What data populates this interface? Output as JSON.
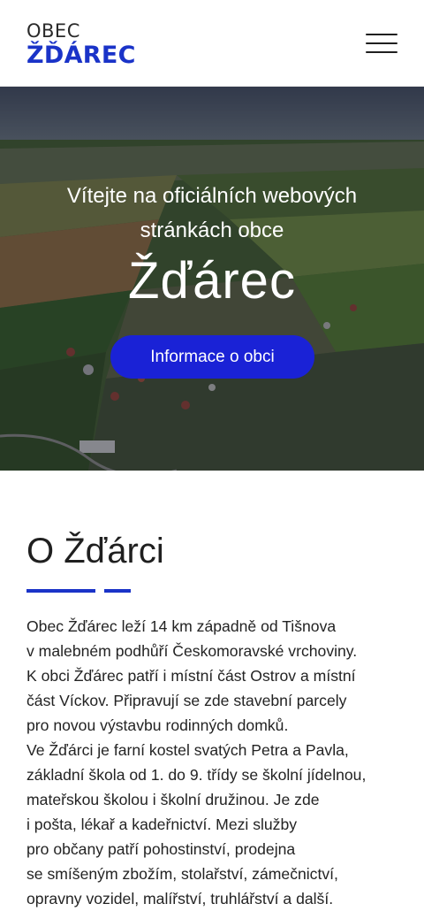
{
  "header": {
    "logo_small": "OBEC",
    "logo_big": "ŽĎÁREC",
    "menu_icon": "hamburger-menu-icon",
    "brand_color": "#1a33c8"
  },
  "hero": {
    "subtitle_line1": "Vítejte na oficiálních webových",
    "subtitle_line2": "stránkách obce",
    "title": "Žďárec",
    "button_label": "Informace o obci",
    "button_color": "#1a22d6"
  },
  "about": {
    "title": "O Žďárci",
    "lines": [
      "Obec Žďárec leží 14 km západně od Tišnova",
      "v malebném podhůří Českomoravské vrchoviny.",
      "K obci Žďárec patří i místní část Ostrov a místní",
      "část Víckov. Připravují se zde stavební parcely",
      "pro novou výstavbu rodinných domků.",
      "Ve Žďárci je farní kostel svatých Petra a Pavla,",
      "základní škola od 1. do 9. třídy se školní jídelnou,",
      "mateřskou školou i školní družinou. Je zde",
      "i pošta, lékař a kadeřnictví. Mezi služby",
      "pro občany patří pohostinství, prodejna",
      "se smíšeným zbožím, stolařství, zámečnictví,",
      "opravny vozidel, malířství, truhlářství a další."
    ]
  }
}
